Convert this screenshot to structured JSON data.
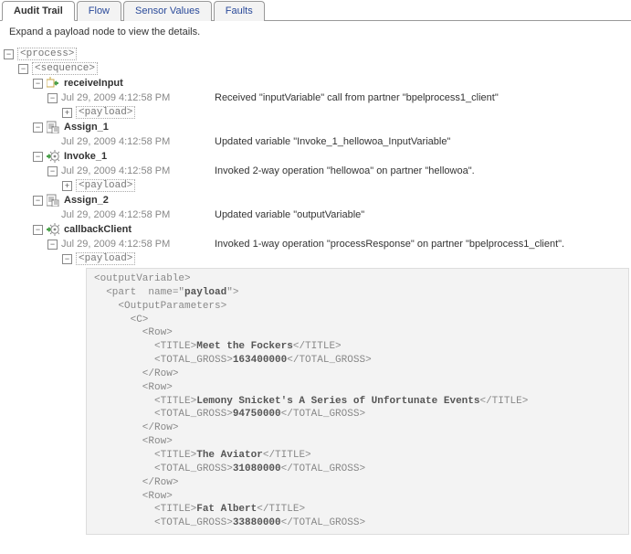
{
  "tabs": {
    "items": [
      {
        "label": "Audit Trail",
        "active": true
      },
      {
        "label": "Flow",
        "active": false
      },
      {
        "label": "Sensor Values",
        "active": false
      },
      {
        "label": "Faults",
        "active": false
      }
    ],
    "audit": "Audit Trail",
    "flow": "Flow",
    "sensor": "Sensor Values",
    "faults": "Faults"
  },
  "instructions": "Expand a payload node to view the details.",
  "tree": {
    "process_tag": "<process>",
    "sequence_tag": "<sequence>",
    "payload_tag": "<payload>",
    "receiveInput": {
      "name": "receiveInput",
      "events": [
        {
          "ts": "Jul 29, 2009 4:12:58 PM",
          "msg": "Received \"inputVariable\" call from partner \"bpelprocess1_client\""
        }
      ]
    },
    "assign1": {
      "name": "Assign_1",
      "events": [
        {
          "ts": "Jul 29, 2009 4:12:58 PM",
          "msg": "Updated variable \"Invoke_1_hellowoa_InputVariable\""
        }
      ]
    },
    "invoke1": {
      "name": "Invoke_1",
      "events": [
        {
          "ts": "Jul 29, 2009 4:12:58 PM",
          "msg": "Invoked 2-way operation \"hellowoa\" on partner \"hellowoa\"."
        }
      ]
    },
    "assign2": {
      "name": "Assign_2",
      "events": [
        {
          "ts": "Jul 29, 2009 4:12:58 PM",
          "msg": "Updated variable \"outputVariable\""
        }
      ]
    },
    "callbackClient": {
      "name": "callbackClient",
      "events": [
        {
          "ts": "Jul 29, 2009 4:12:58 PM",
          "msg": "Invoked 1-way operation \"processResponse\" on partner \"bpelprocess1_client\"."
        }
      ]
    }
  },
  "chart_data": {
    "type": "table",
    "title": "outputVariable / payload / OutputParameters / C",
    "columns": [
      "TITLE",
      "TOTAL_GROSS"
    ],
    "rows": [
      {
        "TITLE": "Meet the Fockers",
        "TOTAL_GROSS": 163400000
      },
      {
        "TITLE": "Lemony Snicket's A Series of Unfortunate Events",
        "TOTAL_GROSS": 94750000
      },
      {
        "TITLE": "The Aviator",
        "TOTAL_GROSS": 31080000
      },
      {
        "TITLE": "Fat Albert",
        "TOTAL_GROSS": 33880000
      }
    ],
    "open_tags": {
      "outputVariable": "<outputVariable>",
      "part": "<part  name=\"",
      "part_val": "payload",
      "part_end": "\">",
      "OutputParameters": "<OutputParameters>",
      "C": "<C>",
      "Row": "<Row>",
      "RowClose": "</Row>",
      "TITLEo": "<TITLE>",
      "TITLEc": "</TITLE>",
      "TGo": "<TOTAL_GROSS>",
      "TGc": "</TOTAL_GROSS>"
    }
  }
}
